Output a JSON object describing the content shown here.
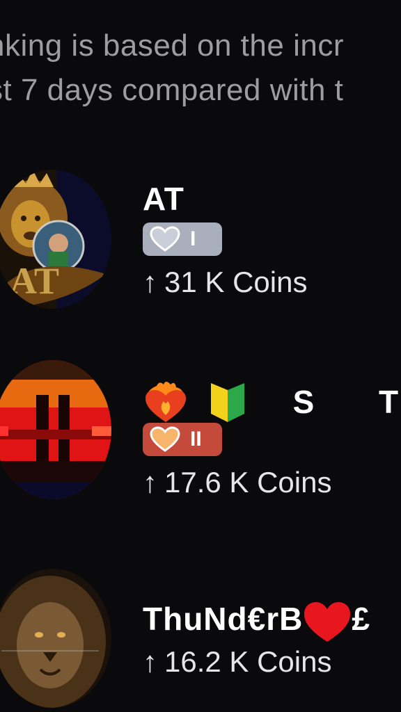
{
  "info_text": {
    "line1": "nking is based on the incr",
    "line2": "st 7 days compared with t"
  },
  "rows": [
    {
      "name": "AT",
      "badge_level": "I",
      "coins": "31 K Coins",
      "arrow": "↑"
    },
    {
      "name_emojis": [
        "heart-on-fire-icon",
        "beginner-symbol-icon"
      ],
      "name": "S T H",
      "badge_level": "II",
      "coins": "17.6 K Coins",
      "arrow": "↑"
    },
    {
      "name": "ThuNd€rB",
      "name_suffix": "£",
      "coins": "16.2 K Coins",
      "arrow": "↑"
    }
  ],
  "colors": {
    "background": "#0a0a0c",
    "badge_level_1": "#a9afbd",
    "badge_level_2": "#c44a3c",
    "subtle_text": "#9c9ca1"
  }
}
